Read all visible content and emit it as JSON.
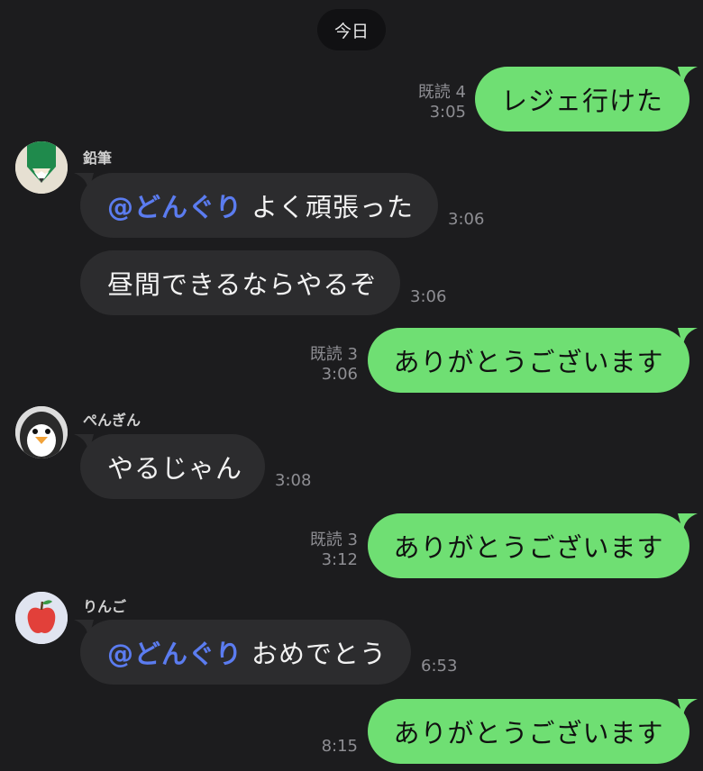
{
  "date_label": "今日",
  "messages": {
    "m1": {
      "text": "レジェ行けた",
      "read": "既読 4",
      "time": "3:05"
    },
    "m2": {
      "sender": "鉛筆",
      "mention": "@どんぐり",
      "text": "よく頑張った",
      "time": "3:06"
    },
    "m3": {
      "text": "昼間できるならやるぞ",
      "time": "3:06"
    },
    "m4": {
      "text": "ありがとうございます",
      "read": "既読 3",
      "time": "3:06"
    },
    "m5": {
      "sender": "ぺんぎん",
      "text": "やるじゃん",
      "time": "3:08"
    },
    "m6": {
      "text": "ありがとうございます",
      "read": "既読 3",
      "time": "3:12"
    },
    "m7": {
      "sender": "りんご",
      "mention": "@どんぐり",
      "text": "おめでとう",
      "time": "6:53"
    },
    "m8": {
      "text": "ありがとうございます",
      "time": "8:15"
    }
  },
  "avatars": {
    "pencil": {
      "icon": "pencil-icon",
      "bg": "#e6e0d2"
    },
    "penguin": {
      "icon": "penguin-icon",
      "bg": "#dcdcdc"
    },
    "apple": {
      "icon": "apple-icon",
      "bg": "#e0e4f0"
    }
  },
  "colors": {
    "background": "#1c1c1e",
    "sent_bubble": "#6fdf73",
    "received_bubble": "#2c2c2e",
    "mention": "#5b7cf0",
    "meta_text": "#8e8e93"
  }
}
